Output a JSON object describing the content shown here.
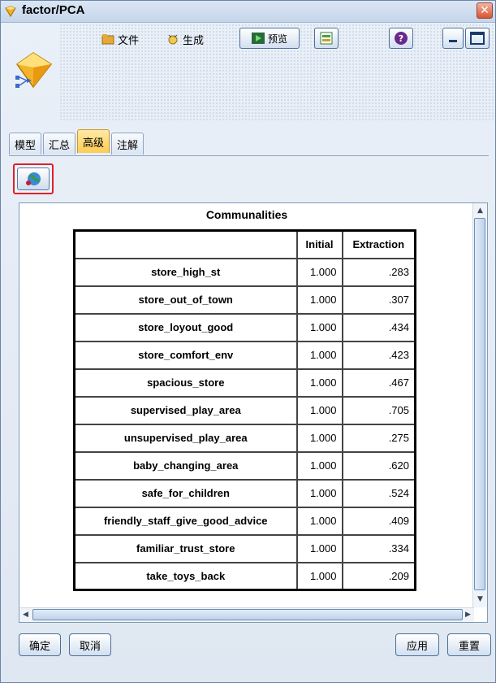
{
  "window": {
    "title": "factor/PCA"
  },
  "toolbar": {
    "file_label": "文件",
    "generate_label": "生成",
    "preview_label": "预览"
  },
  "tabs": [
    {
      "label": "模型",
      "active": false
    },
    {
      "label": "汇总",
      "active": false
    },
    {
      "label": "高级",
      "active": true
    },
    {
      "label": "注解",
      "active": false
    }
  ],
  "table": {
    "title": "Communalities",
    "headers": [
      "",
      "Initial",
      "Extraction"
    ],
    "rows": [
      {
        "name": "store_high_st",
        "initial": "1.000",
        "extraction": ".283"
      },
      {
        "name": "store_out_of_town",
        "initial": "1.000",
        "extraction": ".307"
      },
      {
        "name": "store_loyout_good",
        "initial": "1.000",
        "extraction": ".434"
      },
      {
        "name": "store_comfort_env",
        "initial": "1.000",
        "extraction": ".423"
      },
      {
        "name": "spacious_store",
        "initial": "1.000",
        "extraction": ".467"
      },
      {
        "name": "supervised_play_area",
        "initial": "1.000",
        "extraction": ".705"
      },
      {
        "name": "unsupervised_play_area",
        "initial": "1.000",
        "extraction": ".275"
      },
      {
        "name": "baby_changing_area",
        "initial": "1.000",
        "extraction": ".620"
      },
      {
        "name": "safe_for_children",
        "initial": "1.000",
        "extraction": ".524"
      },
      {
        "name": "friendly_staff_give_good_advice",
        "initial": "1.000",
        "extraction": ".409"
      },
      {
        "name": "familiar_trust_store",
        "initial": "1.000",
        "extraction": ".334"
      },
      {
        "name": "take_toys_back",
        "initial": "1.000",
        "extraction": ".209"
      }
    ]
  },
  "buttons": {
    "ok": "确定",
    "cancel": "取消",
    "apply": "应用",
    "reset": "重置"
  },
  "colors": {
    "active_tab": "#ffcb52",
    "highlight_border": "#e0202a",
    "title_close": "#d9542f"
  }
}
